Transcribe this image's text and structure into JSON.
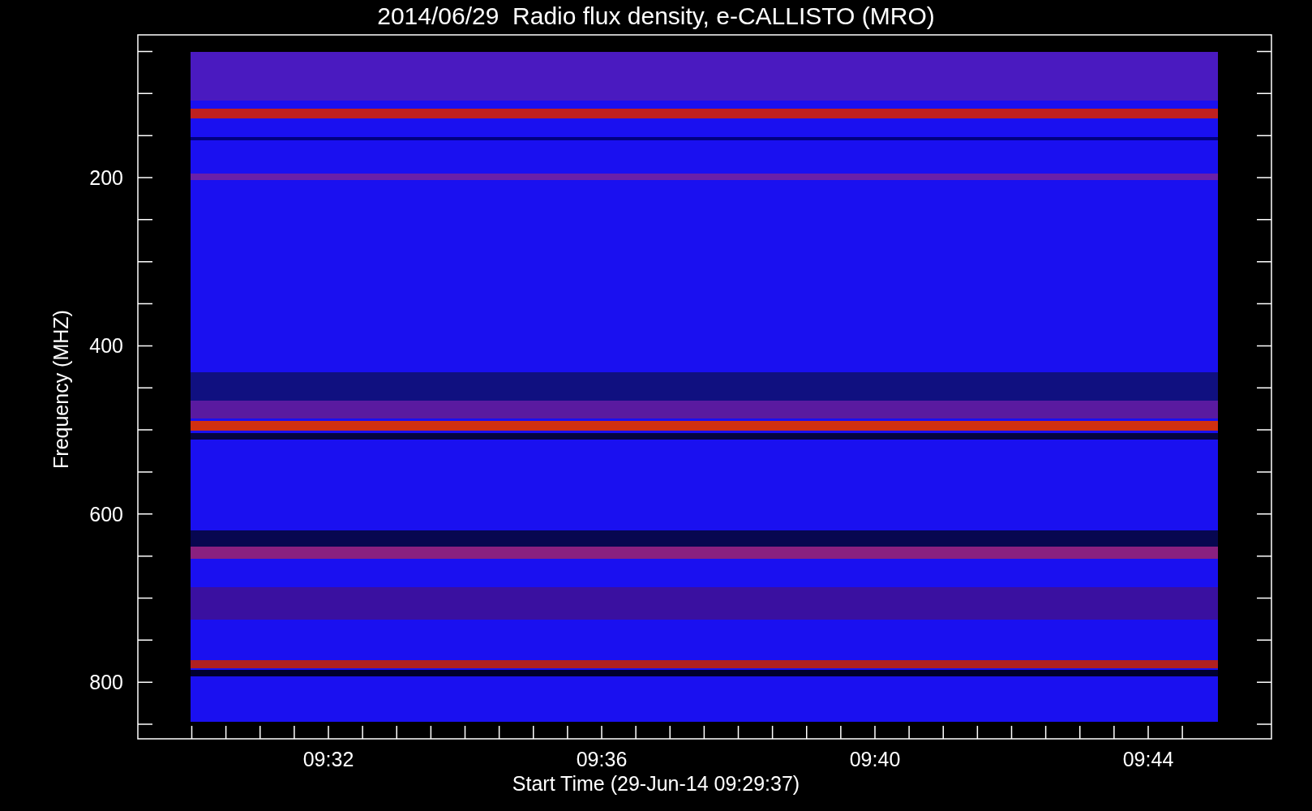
{
  "title": "2014/06/29  Radio flux density, e-CALLISTO (MRO)",
  "y_axis": {
    "label": "Frequency (MHZ)",
    "ticks": [
      "200",
      "400",
      "600",
      "800"
    ]
  },
  "x_axis": {
    "label": "Start Time (29-Jun-14 09:29:37)",
    "ticks": [
      "09:32",
      "09:36",
      "09:40",
      "09:44"
    ]
  }
}
